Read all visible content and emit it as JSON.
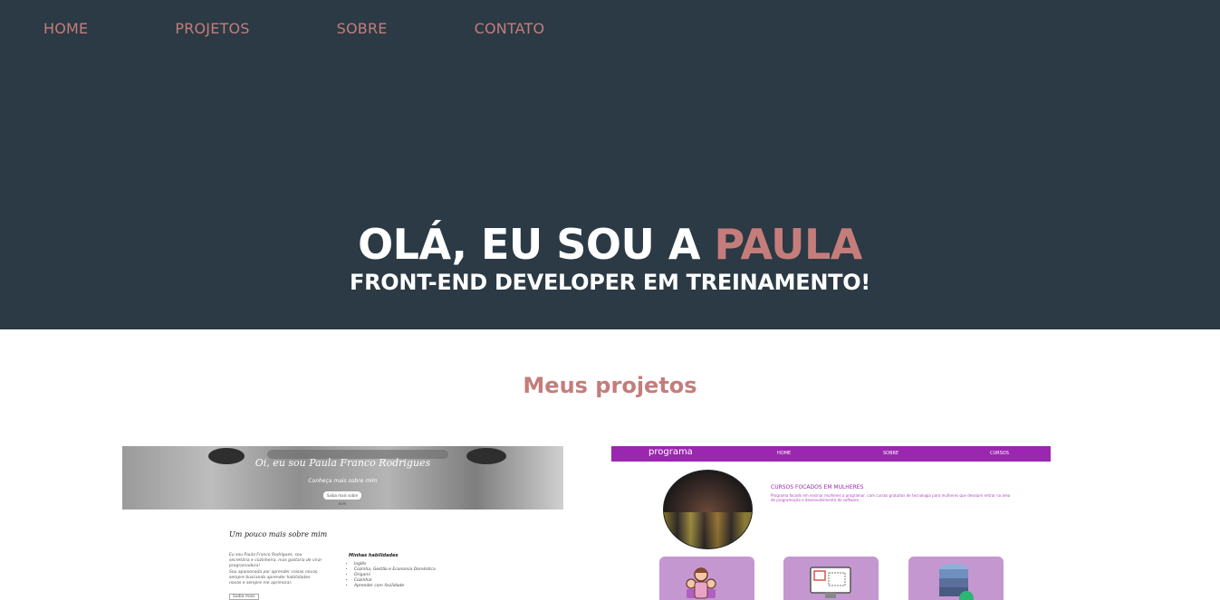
{
  "nav": {
    "home": "HOME",
    "projects": "PROJETOS",
    "about": "SOBRE",
    "contact": "CONTATO"
  },
  "hero": {
    "greeting": "OLÁ, EU SOU A ",
    "name": "PAULA",
    "subtitle": "FRONT-END DEVELOPER EM TREINAMENTO!"
  },
  "projects": {
    "title": "Meus projetos",
    "items": [
      {
        "banner_title": "Oi, eu sou Paula Franco Rodrigues",
        "banner_sub": "Conheça mais sobre mim",
        "banner_button": "Saiba mais sobre mim",
        "section_heading": "Um pouco mais sobre mim",
        "paragraph1": "Eu sou Paula Franco Rodrigues, sou secretária e cozinheira, mas gostaria de virar programadora!",
        "paragraph2": "Sou apaixonada por aprender coisas novas, sempre buscando aprender habilidades novas e sempre me aprimorar.",
        "link": "Saiba mais",
        "skills_heading": "Minhas habilidades",
        "skills": [
          "Inglês",
          "Cozinha, Gestão e Economia Doméstica",
          "Origami",
          "Cozinhar",
          "Aprender com facilidade"
        ]
      },
      {
        "brand": "programa",
        "links": [
          "HOME",
          "SOBRE",
          "CURSOS"
        ],
        "heading": "CURSOS FOCADOS EM MULHERES",
        "text": "Programa focado em ensinar mulheres a programar, com cursos gratuitos de tecnologia para mulheres que desejam entrar na área de programação e desenvolvimento de software."
      }
    ]
  },
  "colors": {
    "hero_bg": "#2b3a44",
    "accent": "#c47d7b",
    "purple": "#9b27b0"
  }
}
